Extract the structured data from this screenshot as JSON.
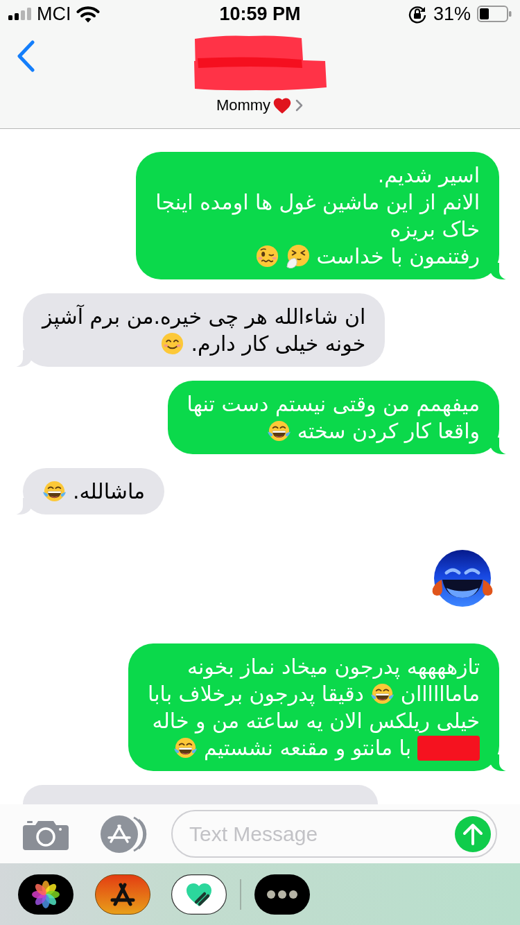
{
  "status_bar": {
    "carrier": "MCI",
    "time": "10:59 PM",
    "battery": "31%"
  },
  "contact": {
    "redacted": true,
    "name": "Mommy"
  },
  "messages": [
    {
      "kind": "text",
      "outgoing": true,
      "lines": [
        [
          {
            "kind": "text",
            "text": "اسیر شدیم."
          }
        ],
        [
          {
            "kind": "text",
            "text": "الانم از این ماشین غول ها اومده اینجا"
          }
        ],
        [
          {
            "kind": "text",
            "text": "خاک بریزه"
          }
        ],
        [
          {
            "kind": "text",
            "text": "رفتنمون با خداست"
          },
          {
            "kind": "sneezing"
          },
          {
            "kind": "woozy"
          }
        ]
      ]
    },
    {
      "kind": "text",
      "outgoing": false,
      "lines": [
        [
          {
            "kind": "text",
            "text": "ان شاءالله هر چی خیره.من برم آشپز"
          }
        ],
        [
          {
            "kind": "text",
            "text": "خونه خیلی کار دارم."
          },
          {
            "kind": "smiling"
          }
        ]
      ]
    },
    {
      "kind": "text",
      "outgoing": true,
      "lines": [
        [
          {
            "kind": "text",
            "text": "میفهمم من وقتی نیستم دست تنها"
          }
        ],
        [
          {
            "kind": "text",
            "text": "واقعا کار کردن سخته"
          },
          {
            "kind": "laughing"
          }
        ]
      ]
    },
    {
      "kind": "text",
      "outgoing": false,
      "lines": [
        [
          {
            "kind": "text",
            "text": "ماشالله."
          },
          {
            "kind": "laughing"
          }
        ]
      ]
    },
    {
      "kind": "jumbo"
    },
    {
      "kind": "text",
      "outgoing": true,
      "lines": [
        [
          {
            "kind": "text",
            "text": "تازههههه پدرجون میخاد نماز بخونه"
          }
        ],
        [
          {
            "kind": "text",
            "text": "ماماااااان"
          },
          {
            "kind": "laughing"
          },
          {
            "kind": "text",
            "text": "دقیقا پدرجون برخلاف بابا"
          }
        ],
        [
          {
            "kind": "text",
            "text": "خیلی ریلکس الان یه ساعته من و خاله"
          }
        ],
        [
          {
            "kind": "redaction"
          },
          {
            "kind": "text",
            "text": "با مانتو و مقنعه نشستیم"
          },
          {
            "kind": "laughing"
          }
        ]
      ]
    },
    {
      "kind": "clipped",
      "outgoing": false
    }
  ],
  "composer": {
    "placeholder": "Text Message"
  }
}
